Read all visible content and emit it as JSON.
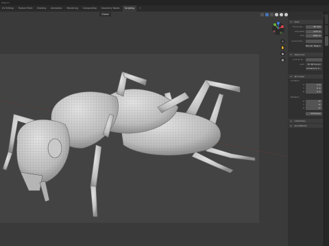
{
  "window": {
    "title": "Insect 1"
  },
  "workspace_tabs": [
    {
      "label": "UV Editing",
      "active": false
    },
    {
      "label": "Texture Paint",
      "active": false
    },
    {
      "label": "Shading",
      "active": false
    },
    {
      "label": "Animation",
      "active": false
    },
    {
      "label": "Rendering",
      "active": false
    },
    {
      "label": "Compositing",
      "active": false
    },
    {
      "label": "Geometry Nodes",
      "active": false
    },
    {
      "label": "Scripting",
      "active": true
    },
    {
      "label": "+",
      "active": false
    }
  ],
  "viewport": {
    "transform_orientation": "Global",
    "pivot_label": "",
    "options_label": "Options"
  },
  "npanel": {
    "view_header": "View",
    "focal_label": "Focal Len...",
    "focal_value": "50 mm",
    "clip_label": "Clip Start",
    "clip_start": "0.01 m",
    "clip_end_label": "End",
    "clip_end": "1000 m",
    "local_camera_label": "Local Cam...",
    "render_region": "Render Region",
    "view_lock_header": "View Lock",
    "lock_object_label": "Lock to O...",
    "lock_label": "Lock",
    "lock_value": "To 3D Cursor",
    "camera_to_view": "Camera to V...",
    "cursor_header": "3D Cursor",
    "location_label": "Location",
    "loc_x": "0 m",
    "loc_y": "0 m",
    "loc_z": "0 m",
    "rotation_label": "Rotation",
    "rot_x": "0°",
    "rot_y": "0°",
    "rot_z": "0°",
    "mode_label": "XYZ Euler",
    "collections_header": "Collections",
    "annotations_header": "Annotations"
  },
  "colors": {
    "accent": "#4772b3",
    "axis_x": "#e0474f",
    "axis_y": "#6db33f",
    "axis_z": "#3d7ee0"
  }
}
